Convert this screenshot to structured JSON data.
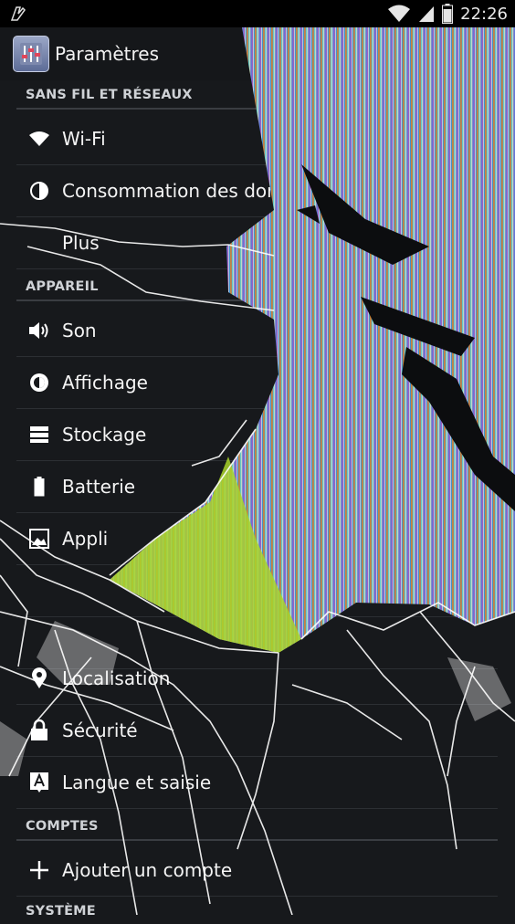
{
  "status_bar": {
    "time": "22:26",
    "icons": [
      "notification-icon",
      "wifi-icon",
      "signal-icon",
      "battery-icon"
    ]
  },
  "action_bar": {
    "title": "Paramètres",
    "icon": "settings-sliders-icon"
  },
  "sections": {
    "wireless": "SANS FIL ET RÉSEAUX",
    "device": "APPAREIL",
    "accounts": "COMPTES",
    "system": "SYSTÈME"
  },
  "items": {
    "wifi": "Wi-Fi",
    "data_usage": "Consommation des don",
    "more": "Plus",
    "sound": "Son",
    "display": "Affichage",
    "storage": "Stockage",
    "battery": "Batterie",
    "apps": "Appli",
    "location": "Localisation",
    "security": "Sécurité",
    "language": "Langue et saisie",
    "add_account": "Ajouter un compte"
  },
  "colors": {
    "background": "#17191c",
    "status_bar": "#000000",
    "divider": "#3a3d42"
  }
}
